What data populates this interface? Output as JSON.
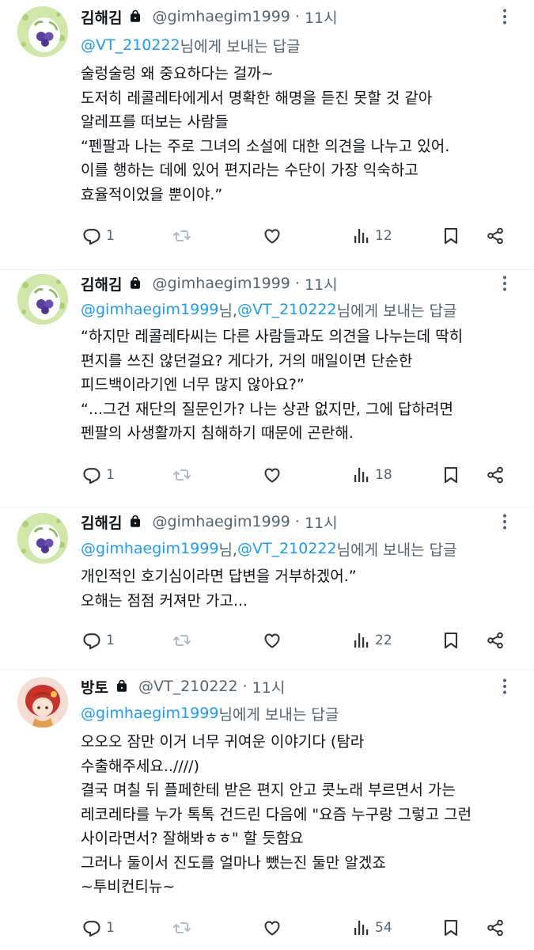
{
  "tweets": [
    {
      "name": "김해김",
      "handle": "@gimhaegim1999",
      "dot": "·",
      "time": "11시",
      "replying_parts": [
        "@VT_210222",
        " 님에게 보내는 답글"
      ],
      "lines": [
        "술렁술렁 왜 중요하다는 걸까~",
        "도저히 레콜레타에게서 명확한 해명을 듣진 못할 것 같아",
        "알레프를 떠보는 사람들",
        "“펜팔과 나는 주로 그녀의 소설에 대한 의견을 나누고 있어.",
        "이를 행하는 데에 있어 편지라는 수단이 가장 익숙하고",
        "효율적이었을 뿐이야.”"
      ],
      "reply_count": "1",
      "retweet_count": "",
      "like_count": "",
      "view_count": "12"
    },
    {
      "name": "김해김",
      "handle": "@gimhaegim1999",
      "dot": "·",
      "time": "11시",
      "replying_parts": [
        "@gimhaegim1999",
        " 님, ",
        "@VT_210222",
        " 님에게 보내는 답글"
      ],
      "lines": [
        "“하지만 레콜레타씨는 다른 사람들과도 의견을 나누는데 딱히",
        "편지를 쓰진 않던걸요? 게다가, 거의 매일이면 단순한",
        "피드백이라기엔 너무 많지 않아요?”",
        "“...그건 재단의 질문인가? 나는 상관 없지만, 그에 답하려면",
        "펜팔의 사생활까지 침해하기 때문에 곤란해."
      ],
      "reply_count": "1",
      "retweet_count": "",
      "like_count": "",
      "view_count": "18"
    },
    {
      "name": "김해김",
      "handle": "@gimhaegim1999",
      "dot": "·",
      "time": "11시",
      "replying_parts": [
        "@gimhaegim1999",
        " 님, ",
        "@VT_210222",
        " 님에게 보내는 답글"
      ],
      "lines": [
        "개인적인 호기심이라면 답변을 거부하겠어.”",
        "오해는 점점 커져만 가고..."
      ],
      "reply_count": "1",
      "retweet_count": "",
      "like_count": "",
      "view_count": "22"
    },
    {
      "name": "방토",
      "handle": "@VT_210222",
      "dot": "·",
      "time": "11시",
      "replying_parts": [
        "@gimhaegim1999",
        " 님에게 보내는 답글"
      ],
      "lines": [
        "오오오 잠만 이거 너무 귀여운 이야기다 (탐라",
        "수출해주세요..////)",
        "결국 며칠 뒤 플페한테 받은 편지 안고 콧노래 부르면서 가는",
        "레코레타를 누가 톡톡 건드린 다음에 \"요즘 누구랑 그렇고 그런",
        "사이라면서? 잘해봐ㅎㅎ\" 할 듯함요",
        "그러나 둘이서 진도를 얼마나 뺐는진 둘만 알겠죠",
        "~투비컨티뉴~"
      ],
      "reply_count": "1",
      "retweet_count": "",
      "like_count": "",
      "view_count": "54"
    }
  ],
  "icons": {
    "lock": "lock-icon",
    "more": "more-icon",
    "reply": "reply-icon",
    "retweet": "retweet-icon",
    "like": "like-icon",
    "views": "views-icon",
    "bookmark": "bookmark-icon",
    "share": "share-icon"
  },
  "colors": {
    "mention": "#1d9bf0",
    "secondary": "#536471",
    "text": "#0f1419",
    "retweet_icon": "#afbcc4"
  }
}
